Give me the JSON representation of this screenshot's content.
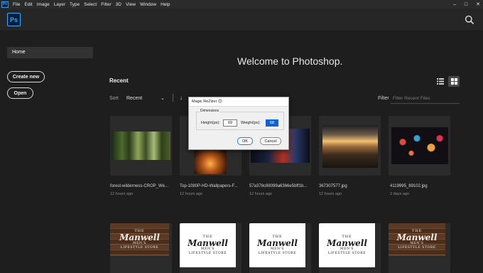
{
  "menubar": {
    "app_icon": "Ps",
    "items": [
      "File",
      "Edit",
      "Image",
      "Layer",
      "Type",
      "Select",
      "Filter",
      "3D",
      "View",
      "Window",
      "Help"
    ],
    "window_controls": [
      "–",
      "□",
      "✕"
    ]
  },
  "header": {
    "logo": "Ps",
    "search_icon": "search-icon"
  },
  "sidebar": {
    "home_label": "Home",
    "create_new_label": "Create new",
    "open_label": "Open"
  },
  "main": {
    "welcome": "Welcome to Photoshop.",
    "recent_heading": "Recent",
    "sort_label": "Sort",
    "sort_value": "Recent",
    "filter_label": "Filter",
    "filter_placeholder": "Filter Recent Files",
    "files": [
      {
        "name": "forest-wilderness-CROP_We...",
        "date": "12 hours ago"
      },
      {
        "name": "Top-1080P-HD-Wallpapers-F...",
        "date": "12 hours ago"
      },
      {
        "name": "57a378c88099a6366e5bff1b...",
        "date": "12 hours ago"
      },
      {
        "name": "367307577.jpg",
        "date": "12 hours ago"
      },
      {
        "name": "4119995_89102.jpg",
        "date": "2 days ago"
      }
    ],
    "logo_cards": {
      "the": "THE",
      "brand": "Manwell",
      "line1": "MEN'S",
      "line2": "LIFESTYLE STORE"
    }
  },
  "dialog": {
    "title": "Magic ReZizer",
    "title_icon": "😊",
    "group_label": "Dimensions",
    "height_label": "Height(px):",
    "height_value": "69",
    "weight_label": "Weight(px):",
    "weight_value": "68",
    "ok_label": "OK",
    "cancel_label": "Cancel"
  }
}
